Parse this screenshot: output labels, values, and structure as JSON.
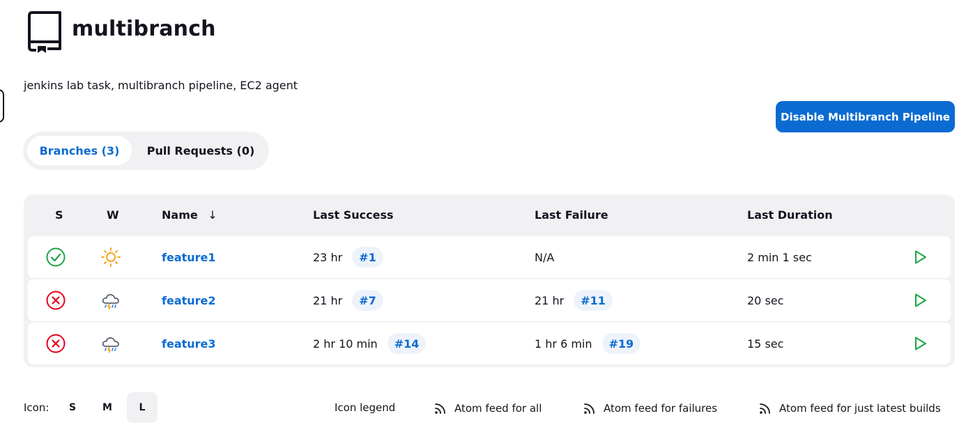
{
  "header": {
    "title": "multibranch",
    "description": "jenkins lab task, multibranch pipeline, EC2 agent"
  },
  "actions": {
    "disable_label": "Disable Multibranch Pipeline"
  },
  "tabs": [
    {
      "label": "Branches (3)",
      "active": true
    },
    {
      "label": "Pull Requests (0)",
      "active": false
    }
  ],
  "table": {
    "headers": {
      "status": "S",
      "weather": "W",
      "name": "Name",
      "sort_indicator": "↓",
      "last_success": "Last Success",
      "last_failure": "Last Failure",
      "last_duration": "Last Duration"
    },
    "rows": [
      {
        "status": "success-icon",
        "weather": "sunny-icon",
        "name": "feature1",
        "last_success_time": "23 hr",
        "last_success_build": "#1",
        "last_failure_time": "N/A",
        "last_failure_build": "",
        "last_duration": "2 min 1 sec"
      },
      {
        "status": "failed-icon",
        "weather": "thunderstorm-icon",
        "name": "feature2",
        "last_success_time": "21 hr",
        "last_success_build": "#7",
        "last_failure_time": "21 hr",
        "last_failure_build": "#11",
        "last_duration": "20 sec"
      },
      {
        "status": "failed-icon",
        "weather": "thunderstorm-icon",
        "name": "feature3",
        "last_success_time": "2 hr 10 min",
        "last_success_build": "#14",
        "last_failure_time": "1 hr 6 min",
        "last_failure_build": "#19",
        "last_duration": "15 sec"
      }
    ]
  },
  "footer": {
    "icon_label": "Icon:",
    "sizes": [
      {
        "label": "S",
        "active": false
      },
      {
        "label": "M",
        "active": false
      },
      {
        "label": "L",
        "active": true
      }
    ],
    "icon_legend": "Icon legend",
    "feed_all": "Atom feed for all",
    "feed_failures": "Atom feed for failures",
    "feed_latest": "Atom feed for just latest builds"
  },
  "colors": {
    "accent": "#0b6bd1",
    "success": "#1ea446",
    "failure": "#e6001f",
    "panel": "#f1f1f4",
    "text": "#14141f"
  }
}
